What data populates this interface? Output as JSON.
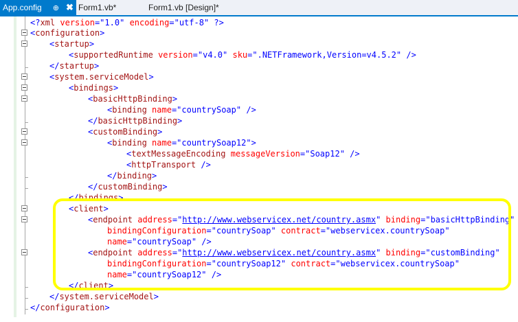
{
  "tabs": [
    {
      "label": "App.config",
      "pin": "⊕",
      "close": "✖"
    },
    {
      "label": "Form1.vb*"
    },
    {
      "label": "Form1.vb [Design]*"
    }
  ],
  "code": {
    "l1": {
      "p1": "<?",
      "e": "xml",
      "sp1": " ",
      "a1": "version",
      "eq1": "=\"",
      "v1": "1.0",
      "q1": "\"",
      "sp2": " ",
      "a2": "encoding",
      "eq2": "=\"",
      "v2": "utf-8",
      "q2": "\"",
      "end": " ?>"
    },
    "l2": {
      "o": "<",
      "e": "configuration",
      "c": ">"
    },
    "l3": {
      "o": "<",
      "e": "startup",
      "c": ">"
    },
    "l4": {
      "o": "<",
      "e": "supportedRuntime",
      "sp1": " ",
      "a1": "version",
      "eq1": "=\"",
      "v1": "v4.0",
      "q1": "\"",
      "sp2": " ",
      "a2": "sku",
      "eq2": "=\"",
      "v2": ".NETFramework,Version=v4.5.2",
      "q2": "\"",
      "c": " />"
    },
    "l5": {
      "o": "</",
      "e": "startup",
      "c": ">"
    },
    "l6": {
      "o": "<",
      "e": "system.serviceModel",
      "c": ">"
    },
    "l7": {
      "o": "<",
      "e": "bindings",
      "c": ">"
    },
    "l8": {
      "o": "<",
      "e": "basicHttpBinding",
      "c": ">"
    },
    "l9": {
      "o": "<",
      "e": "binding",
      "sp1": " ",
      "a1": "name",
      "eq1": "=\"",
      "v1": "countrySoap",
      "q1": "\"",
      "c": " />"
    },
    "l10": {
      "o": "</",
      "e": "basicHttpBinding",
      "c": ">"
    },
    "l11": {
      "o": "<",
      "e": "customBinding",
      "c": ">"
    },
    "l12": {
      "o": "<",
      "e": "binding",
      "sp1": " ",
      "a1": "name",
      "eq1": "=\"",
      "v1": "countrySoap12",
      "q1": "\"",
      "c": ">"
    },
    "l13": {
      "o": "<",
      "e": "textMessageEncoding",
      "sp1": " ",
      "a1": "messageVersion",
      "eq1": "=\"",
      "v1": "Soap12",
      "q1": "\"",
      "c": " />"
    },
    "l14": {
      "o": "<",
      "e": "httpTransport",
      "c": " />"
    },
    "l15": {
      "o": "</",
      "e": "binding",
      "c": ">"
    },
    "l16": {
      "o": "</",
      "e": "customBinding",
      "c": ">"
    },
    "l17": {
      "o": "</",
      "e": "bindings",
      "c": ">"
    },
    "l18": {
      "o": "<",
      "e": "client",
      "c": ">"
    },
    "l19": {
      "o": "<",
      "e": "endpoint",
      "sp1": " ",
      "a1": "address",
      "eq1": "=\"",
      "v1": "http://www.webservicex.net/country.asmx",
      "q1": "\"",
      "sp2": " ",
      "a2": "binding",
      "eq2": "=\"",
      "v2": "basicHttpBinding",
      "q2": "\""
    },
    "l20": {
      "a1": "bindingConfiguration",
      "eq1": "=\"",
      "v1": "countrySoap",
      "q1": "\"",
      "sp2": " ",
      "a2": "contract",
      "eq2": "=\"",
      "v2": "webservicex.countrySoap",
      "q2": "\""
    },
    "l21": {
      "a1": "name",
      "eq1": "=\"",
      "v1": "countrySoap",
      "q1": "\"",
      "c": " />"
    },
    "l22": {
      "o": "<",
      "e": "endpoint",
      "sp1": " ",
      "a1": "address",
      "eq1": "=\"",
      "v1": "http://www.webservicex.net/country.asmx",
      "q1": "\"",
      "sp2": " ",
      "a2": "binding",
      "eq2": "=\"",
      "v2": "customBinding",
      "q2": "\""
    },
    "l23": {
      "a1": "bindingConfiguration",
      "eq1": "=\"",
      "v1": "countrySoap12",
      "q1": "\"",
      "sp2": " ",
      "a2": "contract",
      "eq2": "=\"",
      "v2": "webservicex.countrySoap",
      "q2": "\""
    },
    "l24": {
      "a1": "name",
      "eq1": "=\"",
      "v1": "countrySoap12",
      "q1": "\"",
      "c": " />"
    },
    "l25": {
      "o": "</",
      "e": "client",
      "c": ">"
    },
    "l26": {
      "o": "</",
      "e": "system.serviceModel",
      "c": ">"
    },
    "l27": {
      "o": "</",
      "e": "configuration",
      "c": ">"
    }
  },
  "colors": {
    "accent": "#007acc",
    "highlight": "#ffff00",
    "element": "#a31515",
    "attribute": "#ff0000",
    "value": "#0000ff"
  }
}
